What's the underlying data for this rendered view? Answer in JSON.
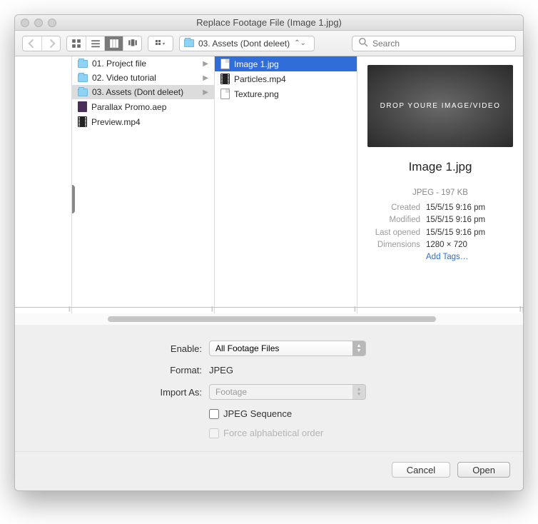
{
  "window": {
    "title": "Replace Footage File (Image 1.jpg)"
  },
  "toolbar": {
    "path": "03. Assets (Dont deleet)",
    "search_placeholder": "Search"
  },
  "columns": {
    "folders": [
      {
        "label": "01. Project file",
        "icon": "folder"
      },
      {
        "label": "02. Video tutorial",
        "icon": "folder"
      },
      {
        "label": "03. Assets (Dont deleet)",
        "icon": "folder",
        "selected": true
      },
      {
        "label": "Parallax Promo.aep",
        "icon": "aep"
      },
      {
        "label": "Preview.mp4",
        "icon": "mov"
      }
    ],
    "files": [
      {
        "label": "Image 1.jpg",
        "icon": "file",
        "selected": true
      },
      {
        "label": "Particles.mp4",
        "icon": "mov"
      },
      {
        "label": "Texture.png",
        "icon": "file"
      }
    ]
  },
  "preview": {
    "thumb_text": "DROP YOURE IMAGE/VIDEO",
    "filename": "Image 1.jpg",
    "type_size": "JPEG - 197 KB",
    "created_label": "Created",
    "created": "15/5/15 9:16 pm",
    "modified_label": "Modified",
    "modified": "15/5/15 9:16 pm",
    "opened_label": "Last opened",
    "opened": "15/5/15 9:16 pm",
    "dimensions_label": "Dimensions",
    "dimensions": "1280 × 720",
    "add_tags": "Add Tags…"
  },
  "options": {
    "enable_label": "Enable:",
    "enable_value": "All Footage Files",
    "format_label": "Format:",
    "format_value": "JPEG",
    "import_as_label": "Import As:",
    "import_as_value": "Footage",
    "jpeg_sequence": "JPEG Sequence",
    "force_alpha": "Force alphabetical order"
  },
  "footer": {
    "cancel": "Cancel",
    "open": "Open"
  }
}
